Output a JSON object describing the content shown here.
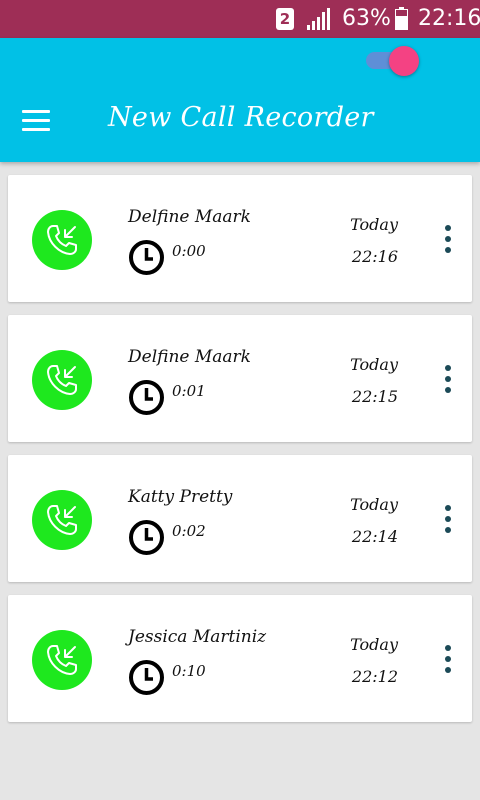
{
  "status_bar": {
    "sim_slot": "2",
    "battery_percent": "63%",
    "time": "22:16",
    "icons": [
      "sim-2-icon",
      "signal-icon",
      "battery-icon"
    ]
  },
  "app_bar": {
    "title": "New Call Recorder",
    "recording_enabled": true,
    "icons": [
      "menu-icon"
    ],
    "colors": {
      "app_bar": "#01c1e6",
      "status_bar": "#9e2e56",
      "toggle_knob": "#f44283",
      "avatar": "#1ee81e"
    }
  },
  "calls": [
    {
      "name": "Delfine Maark",
      "duration": "0:00",
      "day": "Today",
      "time": "22:16"
    },
    {
      "name": "Delfine Maark",
      "duration": "0:01",
      "day": "Today",
      "time": "22:15"
    },
    {
      "name": "Katty Pretty",
      "duration": "0:02",
      "day": "Today",
      "time": "22:14"
    },
    {
      "name": "Jessica Martiniz",
      "duration": "0:10",
      "day": "Today",
      "time": "22:12"
    }
  ]
}
